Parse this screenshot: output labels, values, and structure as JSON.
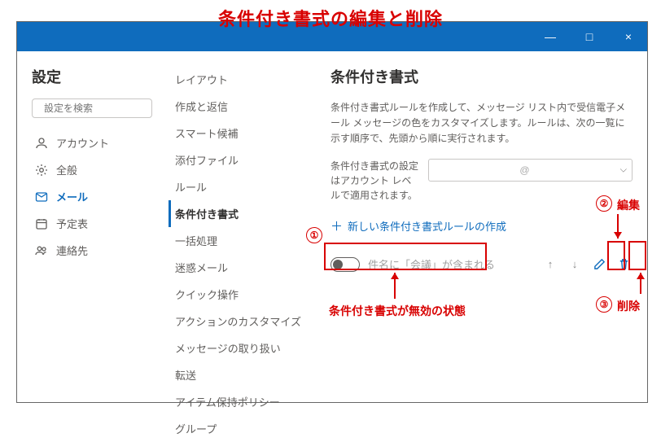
{
  "overlay": {
    "title": "条件付き書式の編集と削除",
    "disabled_note": "条件付き書式が無効の状態",
    "edit_label": "編集",
    "delete_label": "削除",
    "step1": "①",
    "step2": "②",
    "step3": "③"
  },
  "titlebar": {
    "minimize": "―",
    "maximize": "□",
    "close": "×"
  },
  "left": {
    "heading": "設定",
    "search_placeholder": "設定を検索",
    "nav": [
      {
        "key": "account",
        "label": "アカウント"
      },
      {
        "key": "general",
        "label": "全般"
      },
      {
        "key": "mail",
        "label": "メール"
      },
      {
        "key": "calendar",
        "label": "予定表"
      },
      {
        "key": "contacts",
        "label": "連絡先"
      }
    ],
    "active": "mail"
  },
  "mid": {
    "items": [
      "レイアウト",
      "作成と返信",
      "スマート候補",
      "添付ファイル",
      "ルール",
      "条件付き書式",
      "一括処理",
      "迷惑メール",
      "クイック操作",
      "アクションのカスタマイズ",
      "メッセージの取り扱い",
      "転送",
      "アイテム保持ポリシー",
      "グループ"
    ],
    "active_index": 5
  },
  "right": {
    "heading": "条件付き書式",
    "description": "条件付き書式ルールを作成して、メッセージ リスト内で受信電子メール メッセージの色をカスタマイズします。ルールは、次の一覧に示す順序で、先頭から順に実行されます。",
    "scope_text": "条件付き書式の設定はアカウント レベルで適用されます。",
    "account_at": "@",
    "new_rule_label": "新しい条件付き書式ルールの作成",
    "rule": {
      "enabled": false,
      "name": "件名に「会議」が含まれる"
    },
    "icons": {
      "up": "↑",
      "down": "↓",
      "edit": "pencil-icon",
      "delete": "trash-icon"
    }
  }
}
